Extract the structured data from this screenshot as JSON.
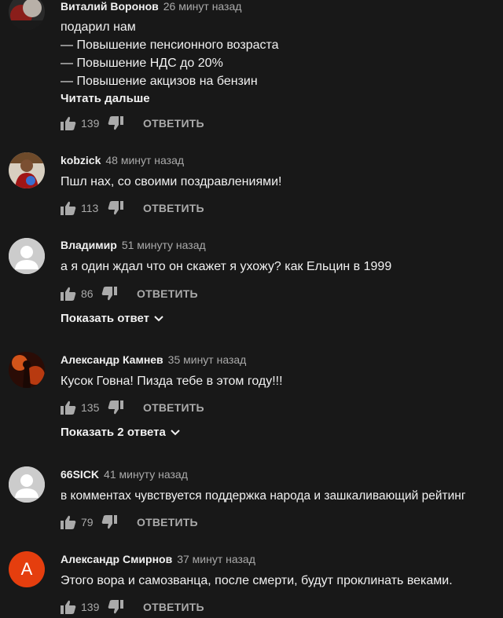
{
  "comments": [
    {
      "author": "Виталий Воронов",
      "time": "26 минут назад",
      "text": "подарил нам\n— Повышение пенсионного возраста\n— Повышение НДС до 20%\n— Повышение акцизов на бензин",
      "read_more": "Читать дальше",
      "likes": "139",
      "reply": "ОТВЕТИТЬ"
    },
    {
      "author": "kobzick",
      "time": "48 минут назад",
      "text": "Пшл нах, со своими поздравлениями!",
      "likes": "113",
      "reply": "ОТВЕТИТЬ"
    },
    {
      "author": "Владимир",
      "time": "51 минуту назад",
      "text": "а я один ждал что он скажет я ухожу? как Ельцин в 1999",
      "likes": "86",
      "reply": "ОТВЕТИТЬ",
      "show_replies": "Показать ответ"
    },
    {
      "author": "Александр Камнев",
      "time": "35 минут назад",
      "text": "Кусок Говна! Пизда тебе в этом году!!!",
      "likes": "135",
      "reply": "ОТВЕТИТЬ",
      "show_replies": "Показать 2 ответа"
    },
    {
      "author": "66SICK",
      "time": "41 минуту назад",
      "text": "в комментах чувствуется поддержка народа и зашкаливающий рейтинг",
      "likes": "79",
      "reply": "ОТВЕТИТЬ"
    },
    {
      "author": "Александр Смирнов",
      "time": "37 минут назад",
      "text": "Этого вора и самозванца, после смерти, будут проклинать веками.",
      "likes": "139",
      "reply": "ОТВЕТИТЬ",
      "avatar_letter": "А"
    }
  ],
  "colors": {
    "background": "#181818",
    "text": "#f1f1f1",
    "secondary": "#aaaaaa",
    "avatar_letter_bg": "#e53e0e",
    "default_avatar_bg": "#cccccc"
  },
  "icons": {
    "like": "thumb-up-icon",
    "dislike": "thumb-down-icon",
    "expand": "chevron-down-icon"
  }
}
